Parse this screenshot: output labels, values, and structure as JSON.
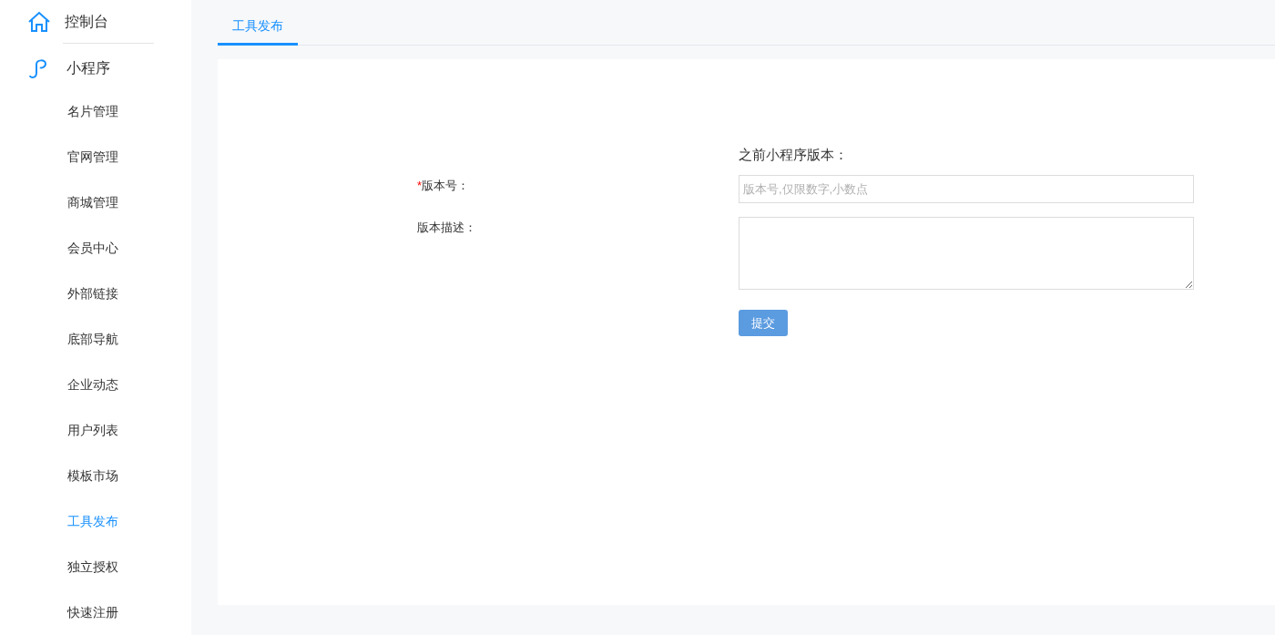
{
  "sidebar": {
    "sections": [
      {
        "label": "控制台"
      },
      {
        "label": "小程序"
      }
    ],
    "items": [
      {
        "label": "名片管理",
        "selected": false
      },
      {
        "label": "官网管理",
        "selected": false
      },
      {
        "label": "商城管理",
        "selected": false
      },
      {
        "label": "会员中心",
        "selected": false
      },
      {
        "label": "外部链接",
        "selected": false
      },
      {
        "label": "底部导航",
        "selected": false
      },
      {
        "label": "企业动态",
        "selected": false
      },
      {
        "label": "用户列表",
        "selected": false
      },
      {
        "label": "模板市场",
        "selected": false
      },
      {
        "label": "工具发布",
        "selected": true
      },
      {
        "label": "独立授权",
        "selected": false
      },
      {
        "label": "快速注册",
        "selected": false
      }
    ]
  },
  "tabs": [
    {
      "label": "工具发布",
      "selected": true
    }
  ],
  "form": {
    "heading": "之前小程序版本：",
    "fields": [
      {
        "kind": "input",
        "label": "版本号：",
        "required_mark": "*",
        "placeholder": "版本号,仅限数字,小数点"
      },
      {
        "kind": "textarea",
        "label": "版本描述："
      }
    ],
    "submit": "提交"
  }
}
